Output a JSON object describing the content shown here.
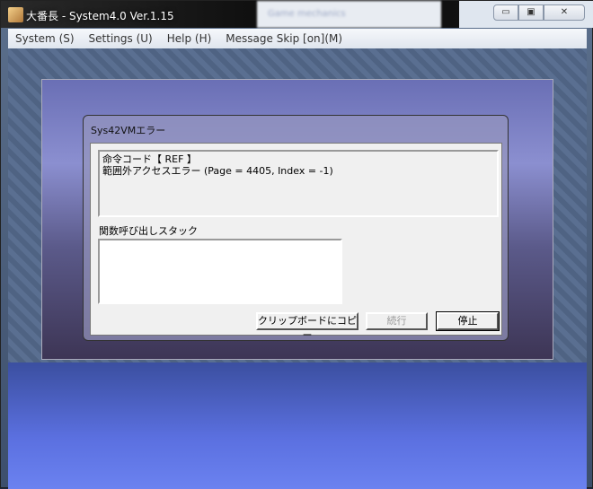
{
  "window": {
    "title": "大番長 - System4.0 Ver.1.15",
    "background_window_text": "Game mechanics"
  },
  "menu": [
    "System (S)",
    "Settings (U)",
    "Help (H)",
    "Message Skip [on](M)"
  ],
  "dialog": {
    "title": "Sys42VMエラー",
    "message_lines": [
      "命令コード【 REF 】",
      "範囲外アクセスエラー (Page = 4405, Index = -1)"
    ],
    "stack_label": "関数呼び出しスタック",
    "stack_value": "",
    "buttons": {
      "copy": "クリップボードにコピー",
      "continue": "続行",
      "stop": "停止"
    }
  },
  "controls": {
    "minimize": "▭",
    "maximize": "▣",
    "close": "✕"
  }
}
